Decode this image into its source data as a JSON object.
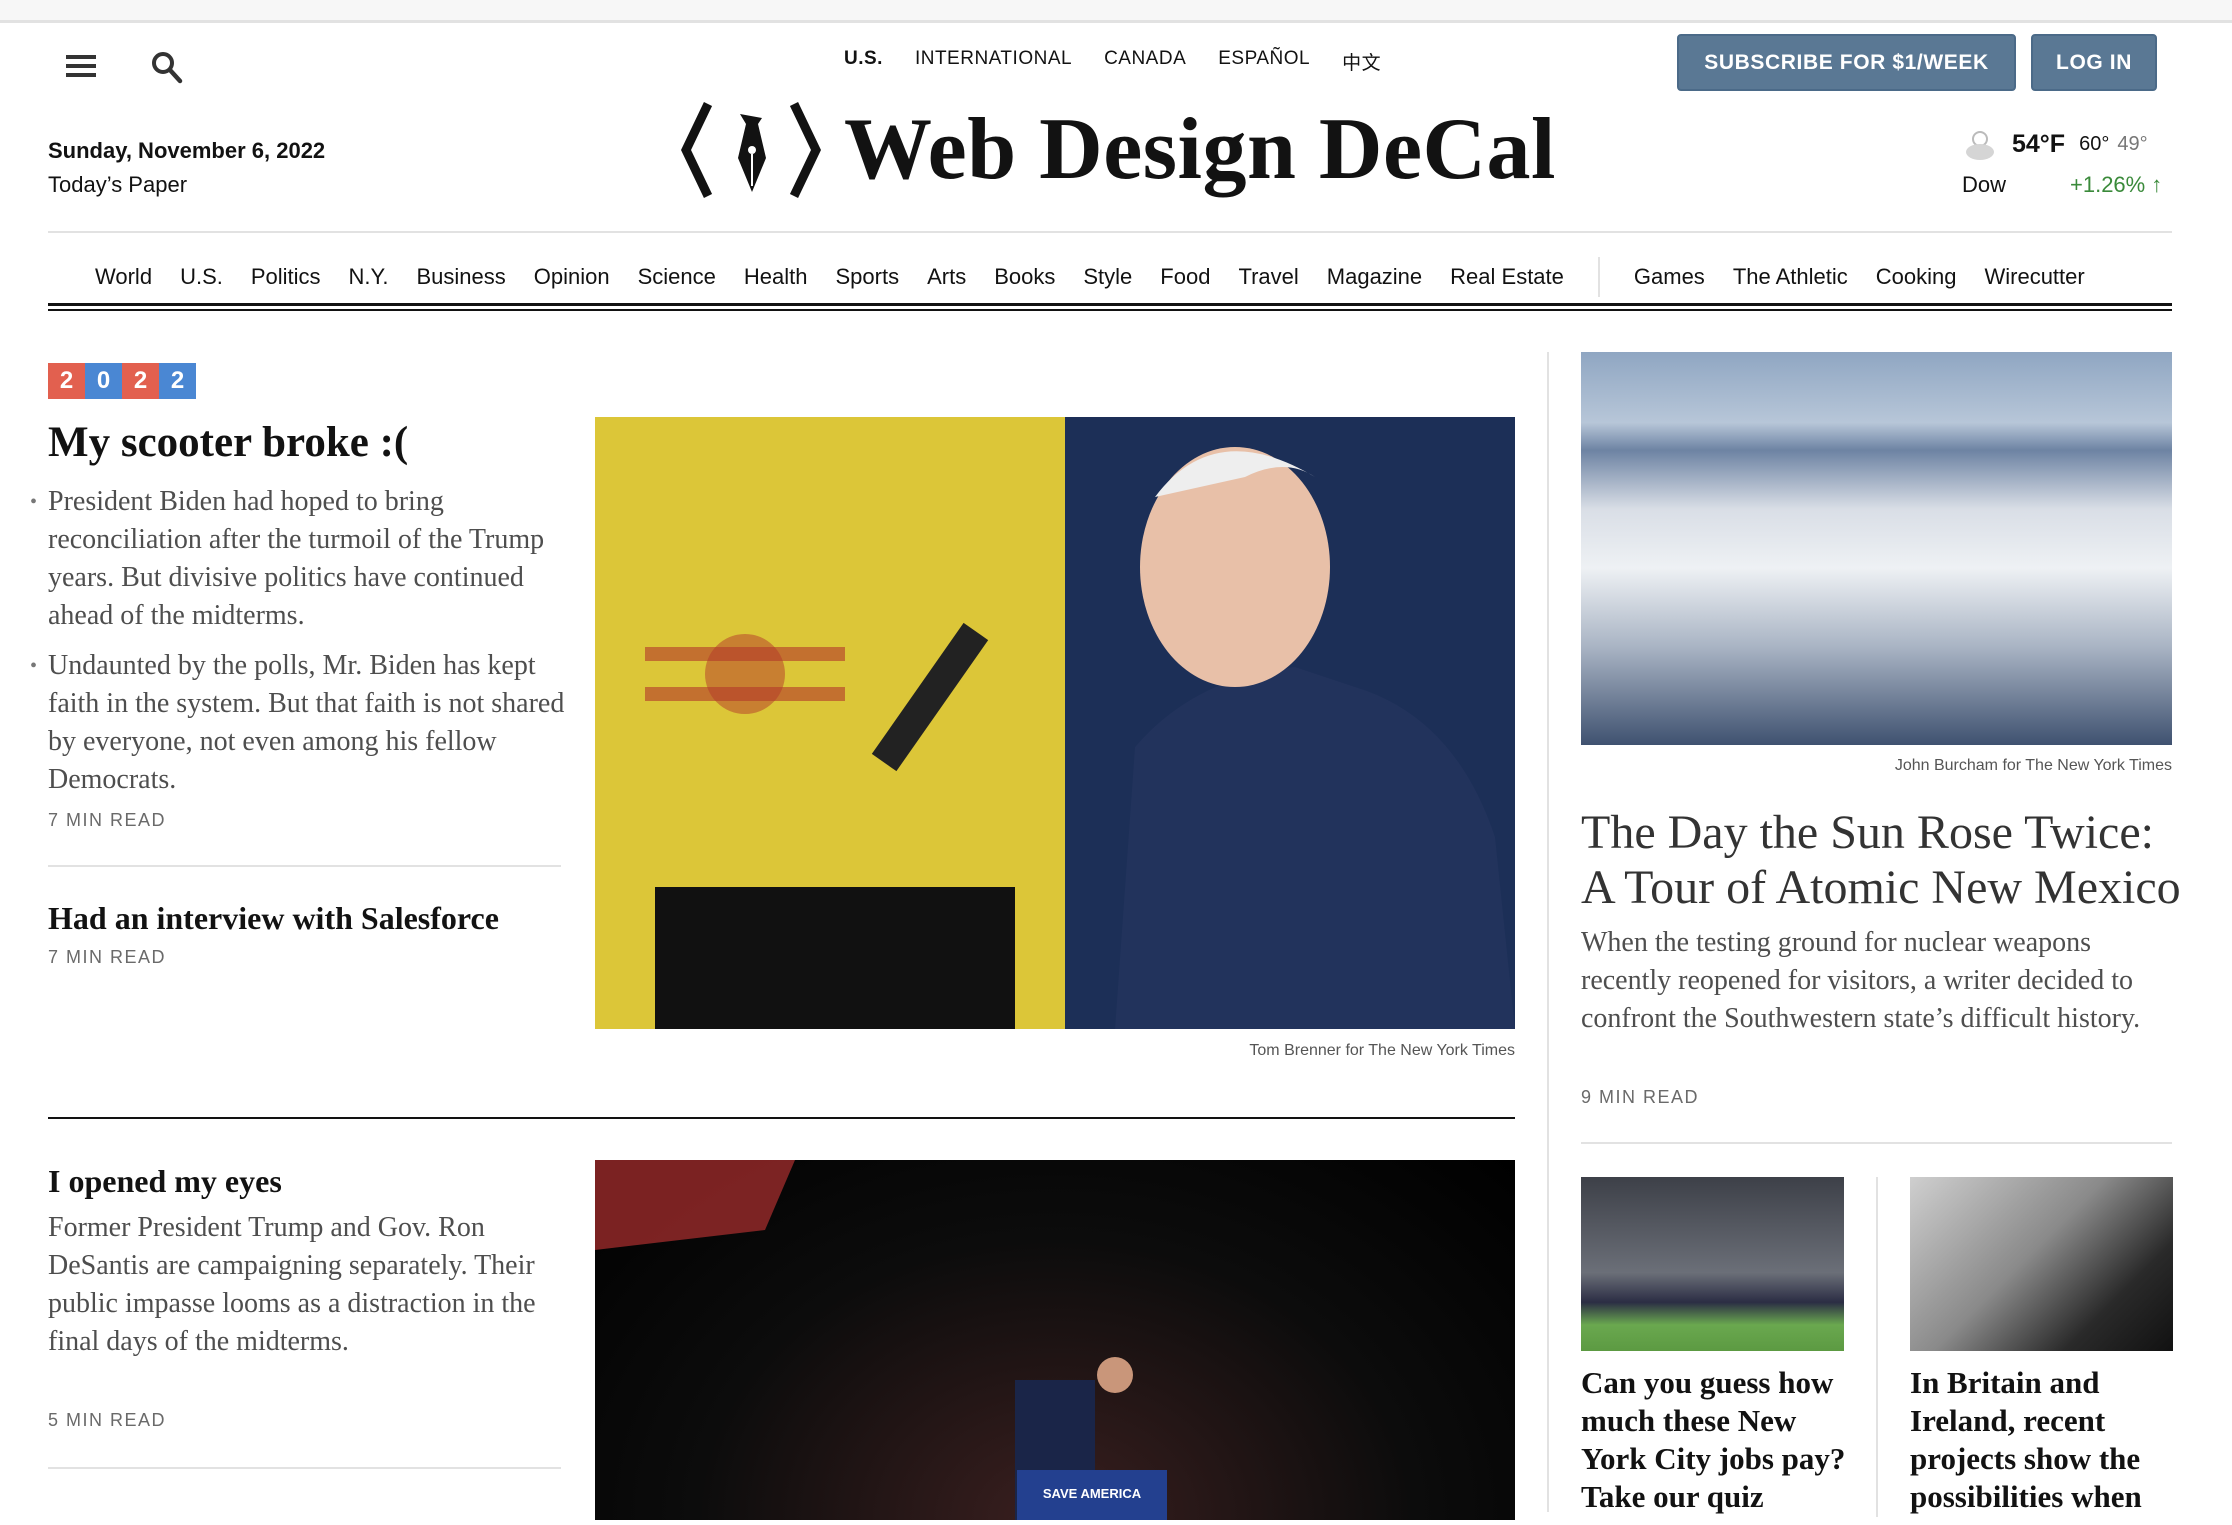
{
  "header": {
    "editions": [
      "U.S.",
      "INTERNATIONAL",
      "CANADA",
      "ESPAÑOL",
      "中文"
    ],
    "subscribe_label": "SUBSCRIBE FOR $1/WEEK",
    "login_label": "LOG IN",
    "date": "Sunday, November 6, 2022",
    "todays_paper": "Today’s Paper",
    "logo_text": "Web Design DeCal",
    "weather": {
      "temp": "54°F",
      "high": "60°",
      "low": "49°",
      "icon": "cloud-icon"
    },
    "market": {
      "label": "Dow",
      "change": "+1.26%",
      "arrow": "↑",
      "color": "#3a8a3a"
    }
  },
  "nav": {
    "sections": [
      "World",
      "U.S.",
      "Politics",
      "N.Y.",
      "Business",
      "Opinion",
      "Science",
      "Health",
      "Sports",
      "Arts",
      "Books",
      "Style",
      "Food",
      "Travel",
      "Magazine",
      "Real Estate"
    ],
    "products": [
      "Games",
      "The Athletic",
      "Cooking",
      "Wirecutter"
    ]
  },
  "badge": {
    "digits": [
      "2",
      "0",
      "2",
      "2"
    ],
    "colors": [
      "#e2604f",
      "#4a87d3",
      "#e2604f",
      "#4a87d3"
    ]
  },
  "main": {
    "lead": {
      "headline": "My scooter broke :(",
      "bullets": [
        "President Biden had hoped to bring reconciliation after the turmoil of the Trump years. But divisive politics have continued ahead of the midterms.",
        "Undaunted by the polls, Mr. Biden has kept faith in the system. But that faith is not shared by everyone, not even among his fellow Democrats."
      ],
      "read_time": "7 MIN READ",
      "image_caption": "Tom Brenner for The New York Times"
    },
    "second": {
      "headline": "Had an interview with Salesforce",
      "read_time": "7 MIN READ"
    },
    "third": {
      "headline": "I opened my eyes",
      "summary": "Former President Trump and Gov. Ron DeSantis are campaigning separately. Their public impasse looms as a distraction in the final days of the midterms.",
      "read_time": "5 MIN READ",
      "image_sign": "SAVE AMERICA"
    }
  },
  "right": {
    "image_caption": "John Burcham for The New York Times",
    "headline": "The Day the Sun Rose Twice: A Tour of Atomic New Mexico",
    "summary": "When the testing ground for nuclear weapons recently reopened for visitors, a writer decided to confront the Southwestern state’s difficult history.",
    "read_time": "9 MIN READ",
    "small": [
      {
        "headline": "Can you guess how much these New York City jobs pay? Take our quiz"
      },
      {
        "headline": "In Britain and Ireland, recent projects show the possibilities when"
      }
    ]
  }
}
